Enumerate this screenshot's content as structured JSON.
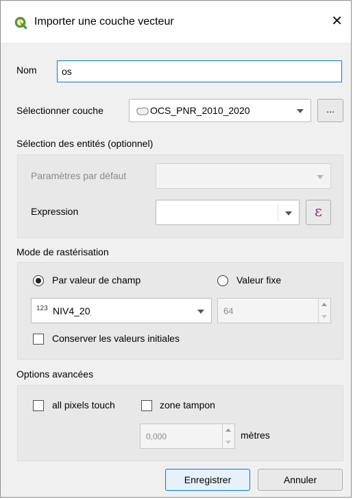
{
  "dialog": {
    "title": "Importer une couche vecteur"
  },
  "fields": {
    "name_label": "Nom",
    "name_value": "os",
    "layer_label": "Sélectionner couche",
    "layer_value": "OCS_PNR_2010_2020",
    "browse_label": "..."
  },
  "selection": {
    "title": "Sélection des entités (optionnel)",
    "defaults_label": "Paramètres par défaut",
    "defaults_value": "",
    "expression_label": "Expression",
    "expression_value": "",
    "expression_button": "ε"
  },
  "raster_mode": {
    "title": "Mode de rastérisation",
    "by_field_label": "Par valeur de champ",
    "by_field_selected": true,
    "fixed_label": "Valeur fixe",
    "fixed_selected": false,
    "field_type_badge": "123",
    "field_value": "NIV4_20",
    "fixed_value": "64",
    "keep_label": "Conserver les valeurs initiales",
    "keep_checked": false
  },
  "advanced": {
    "title": "Options avancées",
    "all_pixels_label": "all pixels touch",
    "all_pixels_checked": false,
    "buffer_label": "zone tampon",
    "buffer_checked": false,
    "buffer_value": "0,000",
    "unit_label": "mètres"
  },
  "buttons": {
    "save": "Enregistrer",
    "cancel": "Annuler"
  },
  "colors": {
    "accent": "#0078d7",
    "window_bg": "#f0f0f0",
    "qgis_green": "#589632"
  }
}
